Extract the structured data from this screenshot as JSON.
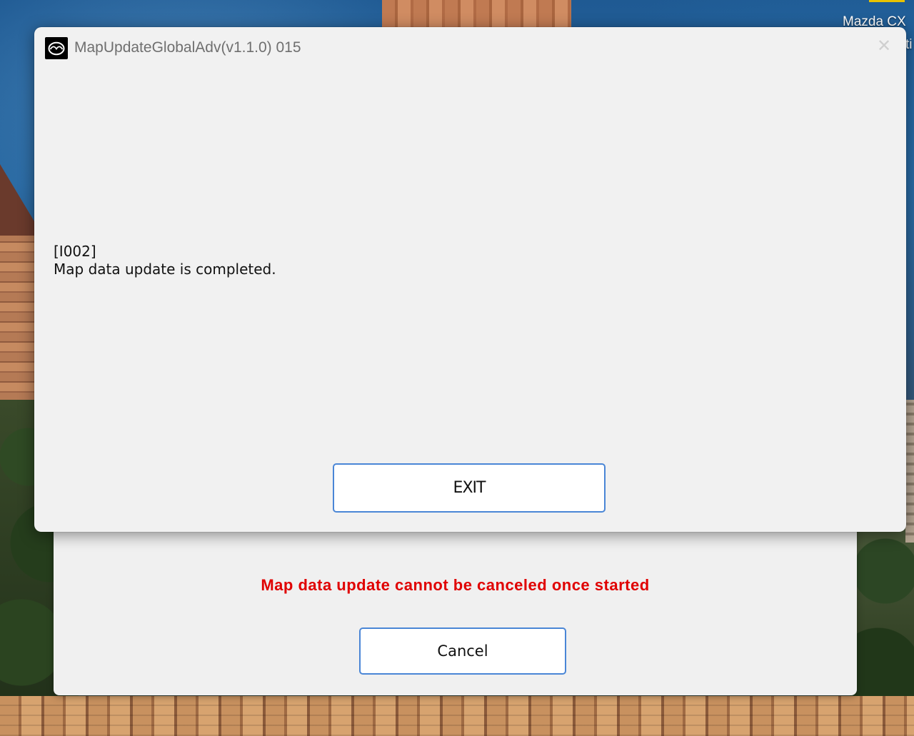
{
  "desktop": {
    "label_line1": "Mazda CX",
    "label_line2": "ti"
  },
  "dialog": {
    "title": "MapUpdateGlobalAdv(v1.1.0) 015",
    "app_icon": "mazda-logo-icon",
    "close_icon": "close-icon",
    "message_code": "[I002]",
    "message_text": "Map data update is completed.",
    "exit_label": "EXIT"
  },
  "background_window": {
    "warning": "Map data update cannot be canceled once started",
    "warning_color": "#e00000",
    "cancel_label": "Cancel"
  },
  "colors": {
    "button_border": "#4a86d6",
    "dialog_bg": "#f1f1f1"
  }
}
